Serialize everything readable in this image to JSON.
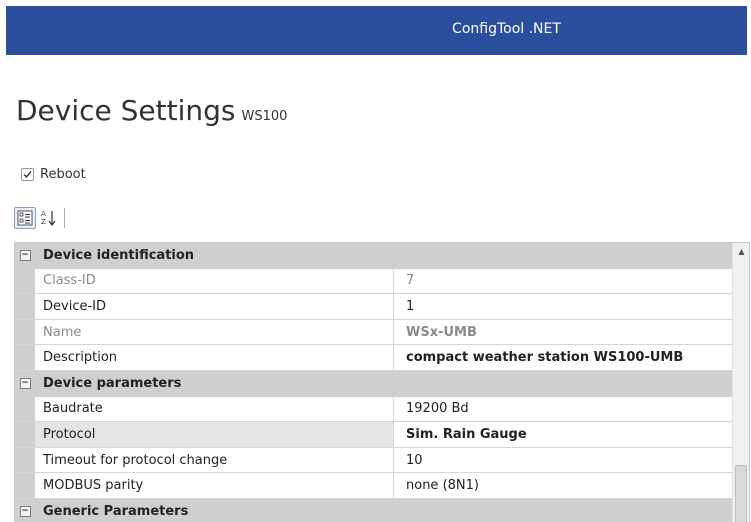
{
  "window": {
    "title": "ConfigTool .NET"
  },
  "page": {
    "title": "Device Settings",
    "device_name": "WS100"
  },
  "reboot": {
    "label": "Reboot",
    "checked": true
  },
  "toolbar": {
    "categorized_icon": "categorized-icon",
    "alphabetical_icon": "sort-az-icon"
  },
  "grid": {
    "categories": [
      {
        "label": "Device identification",
        "expand_symbol": "−"
      },
      {
        "label": "Device parameters",
        "expand_symbol": "−"
      },
      {
        "label": "Generic Parameters",
        "expand_symbol": "−"
      }
    ],
    "identification": [
      {
        "name": "Class-ID",
        "value": "7"
      },
      {
        "name": "Device-ID",
        "value": "1"
      },
      {
        "name": "Name",
        "value": "WSx-UMB"
      },
      {
        "name": "Description",
        "value": "compact weather station WS100-UMB"
      }
    ],
    "parameters": [
      {
        "name": "Baudrate",
        "value": "19200 Bd"
      },
      {
        "name": "Protocol",
        "value": "Sim. Rain Gauge"
      },
      {
        "name": "Timeout for protocol change",
        "value": "10"
      },
      {
        "name": "MODBUS parity",
        "value": "none (8N1)"
      }
    ]
  },
  "colors": {
    "titlebar": "#2b4f9c",
    "category_bg": "#cfcfcf"
  }
}
